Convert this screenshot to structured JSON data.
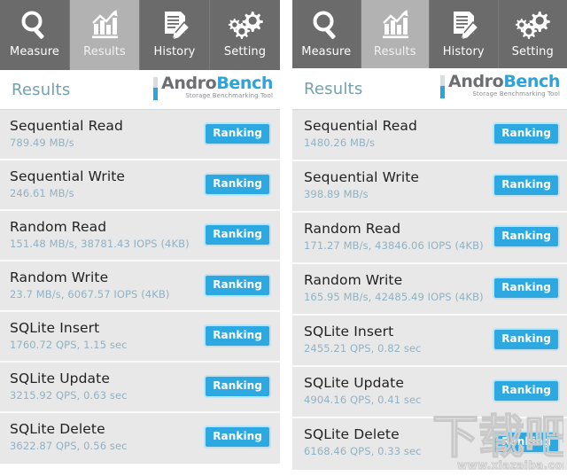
{
  "app": {
    "name": "AndroBench",
    "brand_first": "Andro",
    "brand_second": "Bench",
    "tagline": "Storage Benchmarking Tool",
    "accent_color": "#2aa4dd",
    "tabbar_color": "#6b6b6b",
    "active_tab_color": "#b2b2b2",
    "row_color": "#e8e8e8",
    "value_color": "#8fb2c4"
  },
  "tabs": [
    {
      "id": "measure",
      "label": "Measure",
      "icon": "magnifier-icon",
      "active": false
    },
    {
      "id": "results",
      "label": "Results",
      "icon": "bar-chart-icon",
      "active": true
    },
    {
      "id": "history",
      "label": "History",
      "icon": "document-pen-icon",
      "active": false
    },
    {
      "id": "setting",
      "label": "Setting",
      "icon": "gears-icon",
      "active": false
    }
  ],
  "left_panel": {
    "header": {
      "title": "Results"
    },
    "rows": [
      {
        "title": "Sequential Read",
        "value": "789.49 MB/s",
        "button": "Ranking"
      },
      {
        "title": "Sequential Write",
        "value": "246.61 MB/s",
        "button": "Ranking"
      },
      {
        "title": "Random Read",
        "value": "151.48 MB/s, 38781.43 IOPS (4KB)",
        "button": "Ranking"
      },
      {
        "title": "Random Write",
        "value": "23.7 MB/s, 6067.57 IOPS (4KB)",
        "button": "Ranking"
      },
      {
        "title": "SQLite Insert",
        "value": "1760.72 QPS, 1.15 sec",
        "button": "Ranking"
      },
      {
        "title": "SQLite Update",
        "value": "3215.92 QPS, 0.63 sec",
        "button": "Ranking"
      },
      {
        "title": "SQLite Delete",
        "value": "3622.87 QPS, 0.56 sec",
        "button": "Ranking"
      }
    ]
  },
  "right_panel": {
    "header": {
      "title": "Results"
    },
    "rows": [
      {
        "title": "Sequential Read",
        "value": "1480.26 MB/s",
        "button": "Ranking"
      },
      {
        "title": "Sequential Write",
        "value": "398.89 MB/s",
        "button": "Ranking"
      },
      {
        "title": "Random Read",
        "value": "171.27 MB/s, 43846.06 IOPS (4KB)",
        "button": "Ranking"
      },
      {
        "title": "Random Write",
        "value": "165.95 MB/s, 42485.49 IOPS (4KB)",
        "button": "Ranking"
      },
      {
        "title": "SQLite Insert",
        "value": "2455.21 QPS, 0.82 sec",
        "button": "Ranking"
      },
      {
        "title": "SQLite Update",
        "value": "4904.16 QPS, 0.41 sec",
        "button": "Ranking"
      },
      {
        "title": "SQLite Delete",
        "value": "6168.46 QPS, 0.33 sec",
        "button": "Ranking"
      }
    ]
  },
  "watermark": {
    "text": "下载吧",
    "url": "www.xiazaiba.com"
  }
}
